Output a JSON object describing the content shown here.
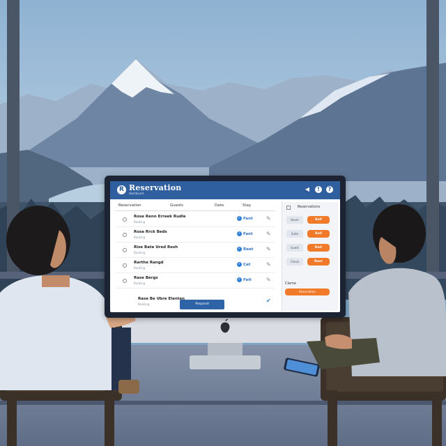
{
  "colors": {
    "sky_top": "#8fb2d2",
    "sky_bottom": "#c9dbe8",
    "mountain_far": "#8aa2bd",
    "mountain_mid": "#667e9b",
    "forest": "#3c4f63",
    "desk": "#6f7d97",
    "app_header": "#2f5f9f",
    "accent_orange": "#f07a2a",
    "status_blue": "#2f7fd8"
  },
  "app": {
    "title": "Reservation",
    "subtitle": "dashboard",
    "logo_glyph": "R",
    "header_icons": [
      {
        "name": "back-icon",
        "glyph": "◀"
      },
      {
        "name": "info-icon",
        "glyph": "!"
      },
      {
        "name": "help-icon",
        "glyph": "?"
      }
    ],
    "columns": [
      "Reservation",
      "Guests",
      "Date",
      "Stay"
    ],
    "rows": [
      {
        "name": "Rose Renn Erreek Rudle",
        "sub": "Booking",
        "status": "Fant",
        "status_icon": "✓"
      },
      {
        "name": "Rosa Rrck Beds",
        "sub": "Booking",
        "status": "Fant",
        "status_icon": "✓"
      },
      {
        "name": "Rise Bate Ured Resh",
        "sub": "Booking",
        "status": "Reet",
        "status_icon": "✓"
      },
      {
        "name": "Rarthe Rangd",
        "sub": "Booking",
        "status": "Cat",
        "status_icon": "✓"
      },
      {
        "name": "Rase Bergs",
        "sub": "Booking",
        "status": "Feit",
        "status_icon": "✓"
      }
    ],
    "last_row": {
      "name": "Rase Be Ubre Elenten",
      "sub": "Booking"
    },
    "side": {
      "title": "Reservations",
      "accent": "",
      "items": [
        {
          "label": "Room",
          "pill": "Reif"
        },
        {
          "label": "Suite",
          "pill": "Reif"
        },
        {
          "label": "Guest",
          "pill": "Reit"
        },
        {
          "label": "Check",
          "pill": "Reer"
        }
      ],
      "summary": "Cleme",
      "summary_accent": "",
      "cta": "Reservation"
    },
    "footer_button": "Respond"
  }
}
